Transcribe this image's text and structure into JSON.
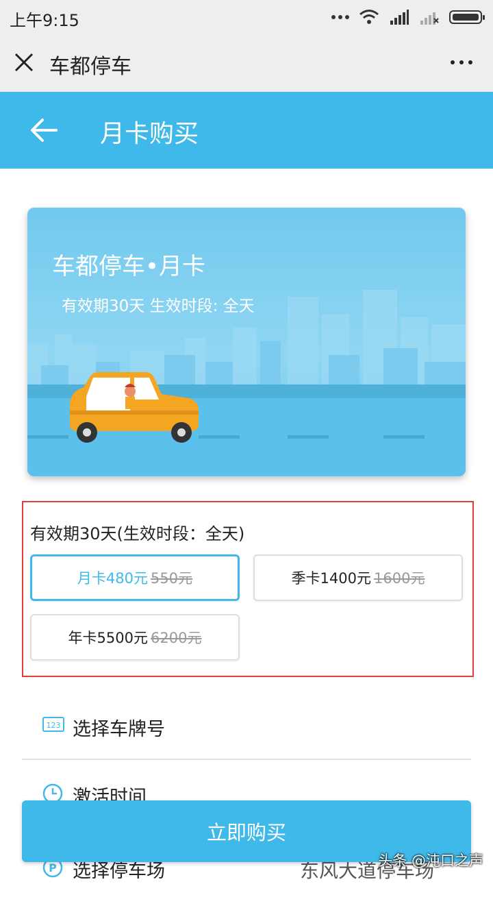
{
  "status_bar": {
    "time": "上午9:15"
  },
  "webview": {
    "title": "车都停车"
  },
  "header": {
    "title": "月卡购买"
  },
  "card": {
    "title": "车都停车•月卡",
    "subtitle": "有效期30天 生效时段: 全天"
  },
  "options": {
    "heading": "有效期30天(生效时段：全天)",
    "items": [
      {
        "name": "月卡480元",
        "original": "550元",
        "selected": true
      },
      {
        "name": "季卡1400元",
        "original": "1600元",
        "selected": false
      },
      {
        "name": "年卡5500元",
        "original": "6200元",
        "selected": false
      }
    ]
  },
  "rows": [
    {
      "label": "选择车牌号",
      "icon": "license-plate-icon"
    },
    {
      "label": "激活时间",
      "icon": "clock-icon"
    },
    {
      "label": "选择停车场",
      "icon": "parking-icon",
      "value": "东风大道停车场"
    }
  ],
  "buy_button": {
    "label": "立即购买"
  },
  "watermark": "头条 @沌口之声",
  "colors": {
    "accent": "#3fb8ea",
    "highlight_border": "#e33a3a",
    "status_bg": "#eeeeef"
  }
}
